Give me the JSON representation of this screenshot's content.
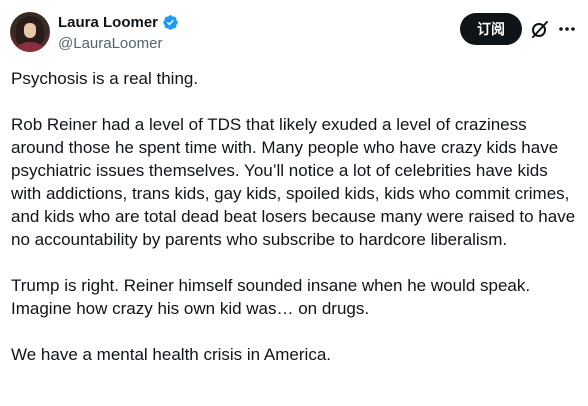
{
  "author": {
    "name": "Laura Loomer",
    "handle": "@LauraLoomer",
    "verified_color": "#1d9bf0"
  },
  "actions": {
    "subscribe_label": "订阅",
    "grok_icon": "grok-icon",
    "more_icon": "more-icon"
  },
  "tweet": {
    "paragraphs": [
      "Psychosis is a real thing.",
      "Rob Reiner had a level of TDS that likely exuded a level of craziness around those he spent time with. Many people who have crazy kids have psychiatric issues themselves. You’ll notice a lot of celebrities have kids with addictions, trans kids, gay kids, spoiled kids, kids who commit crimes, and kids who are total dead beat losers because many were raised to have no accountability by parents who subscribe to hardcore liberalism.",
      "Trump is right. Reiner himself sounded insane when he would speak. Imagine how crazy his own kid was… on drugs.",
      "We have a mental health crisis in America."
    ]
  }
}
